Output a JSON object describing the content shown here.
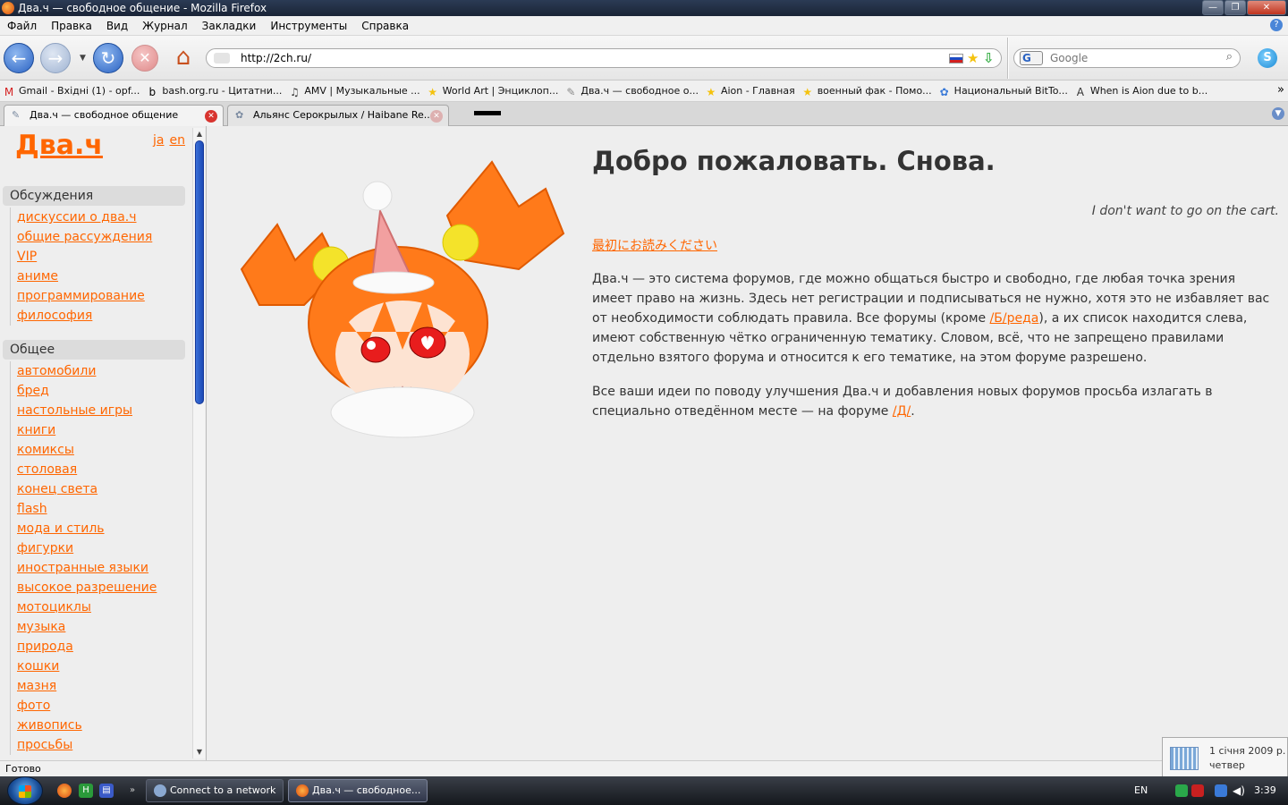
{
  "window": {
    "title": "Два.ч — свободное общение - Mozilla Firefox",
    "minimize": "—",
    "maximize": "❐",
    "close": "✕"
  },
  "menu": [
    "Файл",
    "Правка",
    "Вид",
    "Журнал",
    "Закладки",
    "Инструменты",
    "Справка"
  ],
  "toolbar": {
    "back_glyph": "←",
    "forward_glyph": "→",
    "reload_glyph": "↻",
    "stop_glyph": "✕",
    "home_glyph": "⌂",
    "url": "http://2ch.ru/",
    "search_engine": "G",
    "search_placeholder": "Google"
  },
  "bookmarks": [
    {
      "label": "Gmail - Вхідні (1) - opf...",
      "icon": "M"
    },
    {
      "label": "bash.org.ru - Цитатни...",
      "icon": "b"
    },
    {
      "label": "AMV | Музыкальные ...",
      "icon": "♫"
    },
    {
      "label": "World Art | Энциклоп...",
      "icon": "★"
    },
    {
      "label": "Два.ч — свободное о...",
      "icon": "✎"
    },
    {
      "label": "Aion - Главная",
      "icon": "★"
    },
    {
      "label": "военный фак - Помо...",
      "icon": "★"
    },
    {
      "label": "Национальный BitTo...",
      "icon": "✿"
    },
    {
      "label": "When is Aion due to b...",
      "icon": "A"
    }
  ],
  "bookmarks_more": "»",
  "tabs": [
    {
      "label": "Два.ч — свободное общение",
      "active": true
    },
    {
      "label": "Альянс Серокрылых / Haibane Re...",
      "active": false
    }
  ],
  "sidebar": {
    "logo": "Два.ч",
    "langs": [
      "ja",
      "en"
    ],
    "sections": [
      {
        "title": "Обсуждения",
        "items": [
          "дискуссии о два.ч",
          "общие рассуждения",
          "VIP",
          "аниме",
          "программирование",
          "философия"
        ]
      },
      {
        "title": "Общее",
        "items": [
          "автомобили",
          "бред",
          "настольные игры",
          "книги",
          "комиксы",
          "столовая",
          "конец света",
          "flash",
          "мода и стиль",
          "фигурки",
          "иностранные языки",
          "высокое разрешение",
          "мотоциклы",
          "музыка",
          "природа",
          "кошки",
          "мазня",
          "фото",
          "живопись",
          "просьбы"
        ]
      }
    ]
  },
  "main": {
    "heading": "Добро пожаловать. Снова.",
    "quote": "I don't want to go on the cart.",
    "japanese_link": "最初にお読みください",
    "para1_a": "Два.ч — это система форумов, где можно общаться быстро и свободно, где любая точка зрения имеет право на жизнь. Здесь нет регистрации и подписываться не нужно, хотя это не избавляет вас от необходимости соблюдать правила. Все форумы (кроме ",
    "para1_link": "/Б/реда",
    "para1_b": "), а их список находится слева, имеют собственную чётко ограниченную тематику. Словом, всё, что не запрещено правилами отдельно взятого форума и относится к его тематике, на этом форуме разрешено.",
    "para2_a": "Все ваши идеи по поводу улучшения Два.ч и добавления новых форумов просьба излагать в специально отведённом месте — на форуме ",
    "para2_link": "/Д/",
    "para2_b": "."
  },
  "status": "Готово",
  "tooltip": {
    "date": "1 січня 2009 р.",
    "weekday": "четвер"
  },
  "taskbar": {
    "tasks": [
      "Connect to a network",
      "Два.ч — свободное..."
    ],
    "lang": "EN",
    "time": "3:39"
  },
  "colors": {
    "accent": "#ff6600",
    "text": "#333333",
    "background": "#eeeeee"
  }
}
